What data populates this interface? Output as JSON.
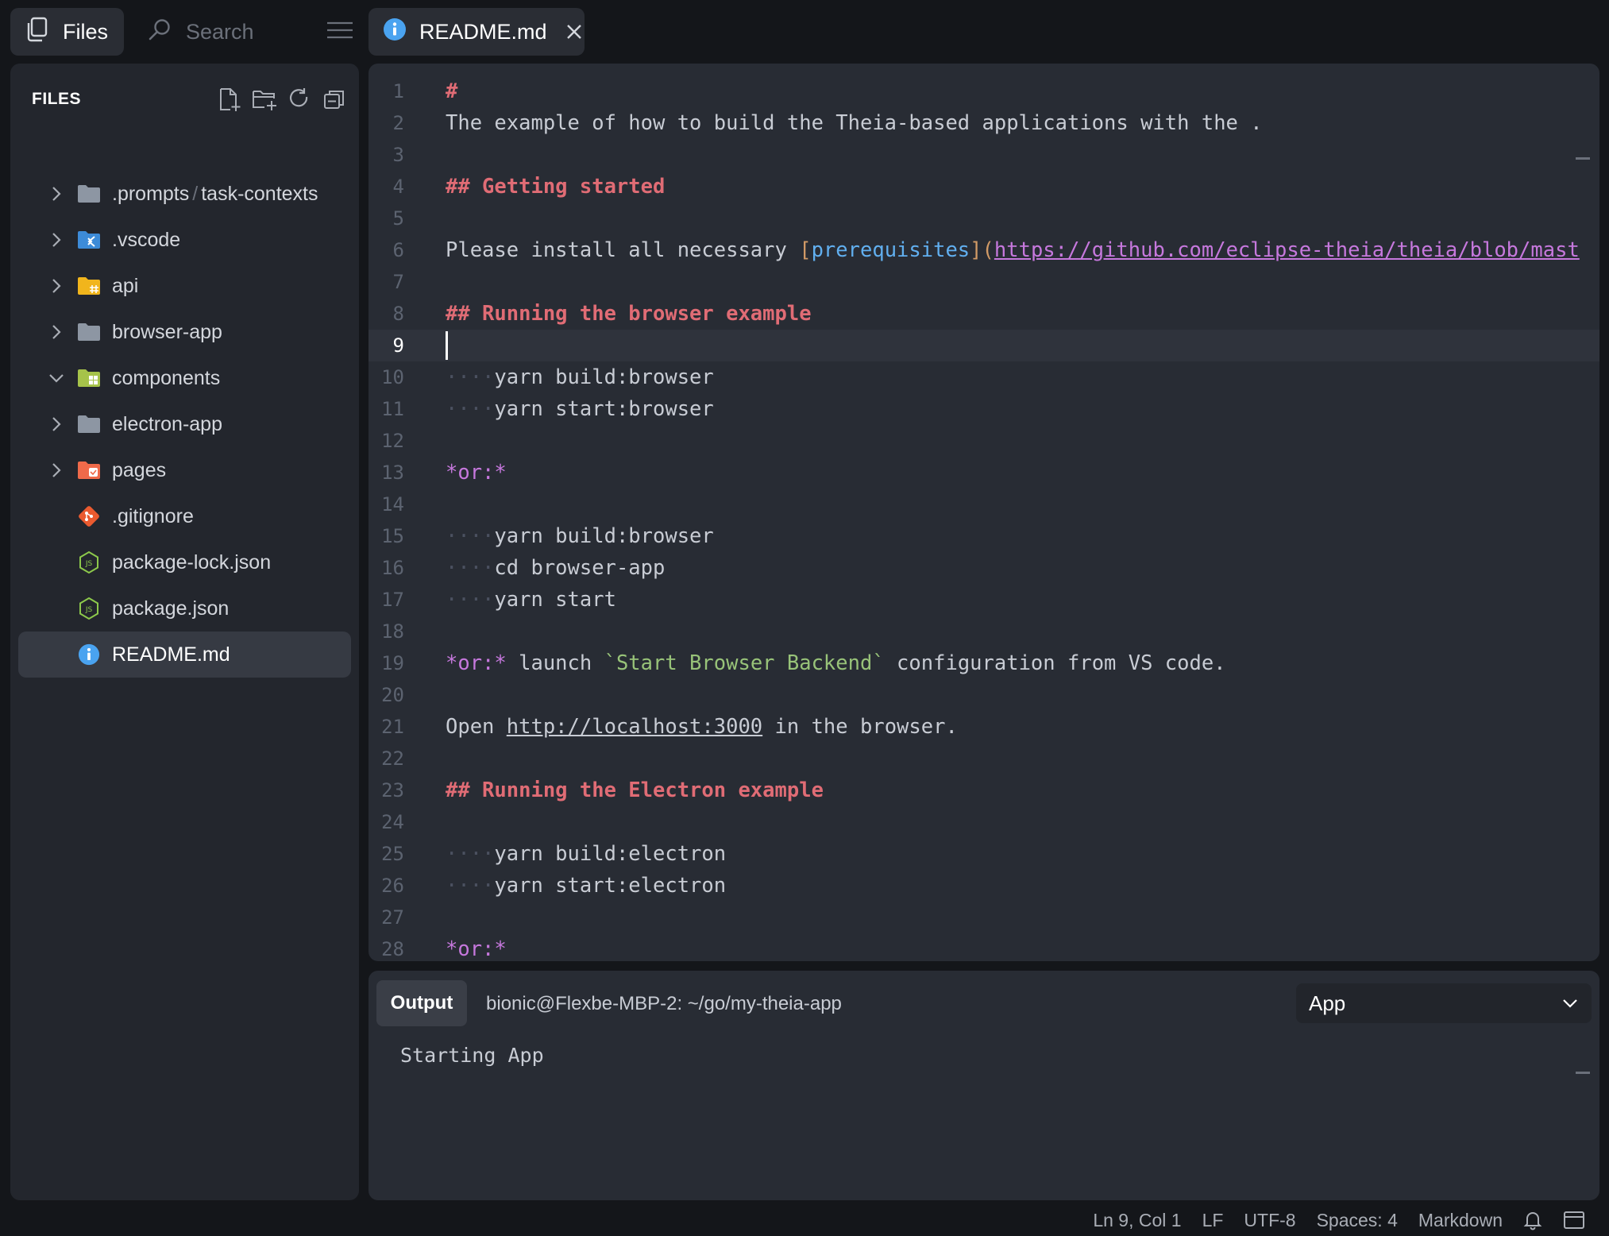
{
  "topbar": {
    "files_label": "Files",
    "search_placeholder": "Search"
  },
  "tab": {
    "label": "README.md"
  },
  "sidebar": {
    "title": "FILES",
    "items": [
      {
        "label": ".prompts",
        "label2": "task-contexts",
        "type": "folder",
        "expanded": false
      },
      {
        "label": ".vscode",
        "type": "folder-vscode",
        "expanded": false
      },
      {
        "label": "api",
        "type": "folder-api",
        "expanded": false
      },
      {
        "label": "browser-app",
        "type": "folder",
        "expanded": false
      },
      {
        "label": "components",
        "type": "folder-components",
        "expanded": true
      },
      {
        "label": "electron-app",
        "type": "folder",
        "expanded": false
      },
      {
        "label": "pages",
        "type": "folder-pages",
        "expanded": false
      },
      {
        "label": ".gitignore",
        "type": "git-file"
      },
      {
        "label": "package-lock.json",
        "type": "node-file"
      },
      {
        "label": "package.json",
        "type": "node-file"
      },
      {
        "label": "README.md",
        "type": "info-file",
        "selected": true
      }
    ]
  },
  "editor": {
    "lines": {
      "l1": "#",
      "l2": "The example of how to build the Theia-based applications with the .",
      "l4": "## Getting started",
      "l6a": "Please install all necessary ",
      "l6b": "[",
      "l6c": "prerequisites",
      "l6d": "](",
      "l6e": "https://github.com/eclipse-theia/theia/blob/mast",
      "l8": "## Running the browser example",
      "l10": "yarn build:browser",
      "l11": "yarn start:browser",
      "l13": "*or:*",
      "l15": "yarn build:browser",
      "l16": "cd browser-app",
      "l17": "yarn start",
      "l19a": "*or:*",
      "l19b": " launch ",
      "l19c": "`Start Browser Backend`",
      "l19d": " configuration from VS code.",
      "l21a": "Open ",
      "l21b": "http://localhost:3000",
      "l21c": " in the browser.",
      "l23": "## Running the Electron example",
      "l25": "yarn build:electron",
      "l26": "yarn start:electron",
      "l28": "*or:*"
    },
    "line_numbers": [
      "1",
      "2",
      "3",
      "4",
      "5",
      "6",
      "7",
      "8",
      "9",
      "10",
      "11",
      "12",
      "13",
      "14",
      "15",
      "16",
      "17",
      "18",
      "19",
      "20",
      "21",
      "22",
      "23",
      "24",
      "25",
      "26",
      "27",
      "28"
    ]
  },
  "panel": {
    "tab_label": "Output",
    "path": "bionic@Flexbe-MBP-2: ~/go/my-theia-app",
    "selected_channel": "App",
    "output_text": "Starting App"
  },
  "statusbar": {
    "position": "Ln 9, Col 1",
    "eol": "LF",
    "encoding": "UTF-8",
    "indent": "Spaces: 4",
    "language": "Markdown"
  },
  "colors": {
    "heading": "#e06c75",
    "link_text": "#61afef",
    "url": "#c678dd",
    "inline_code": "#98c379",
    "bracket": "#d19a66"
  }
}
